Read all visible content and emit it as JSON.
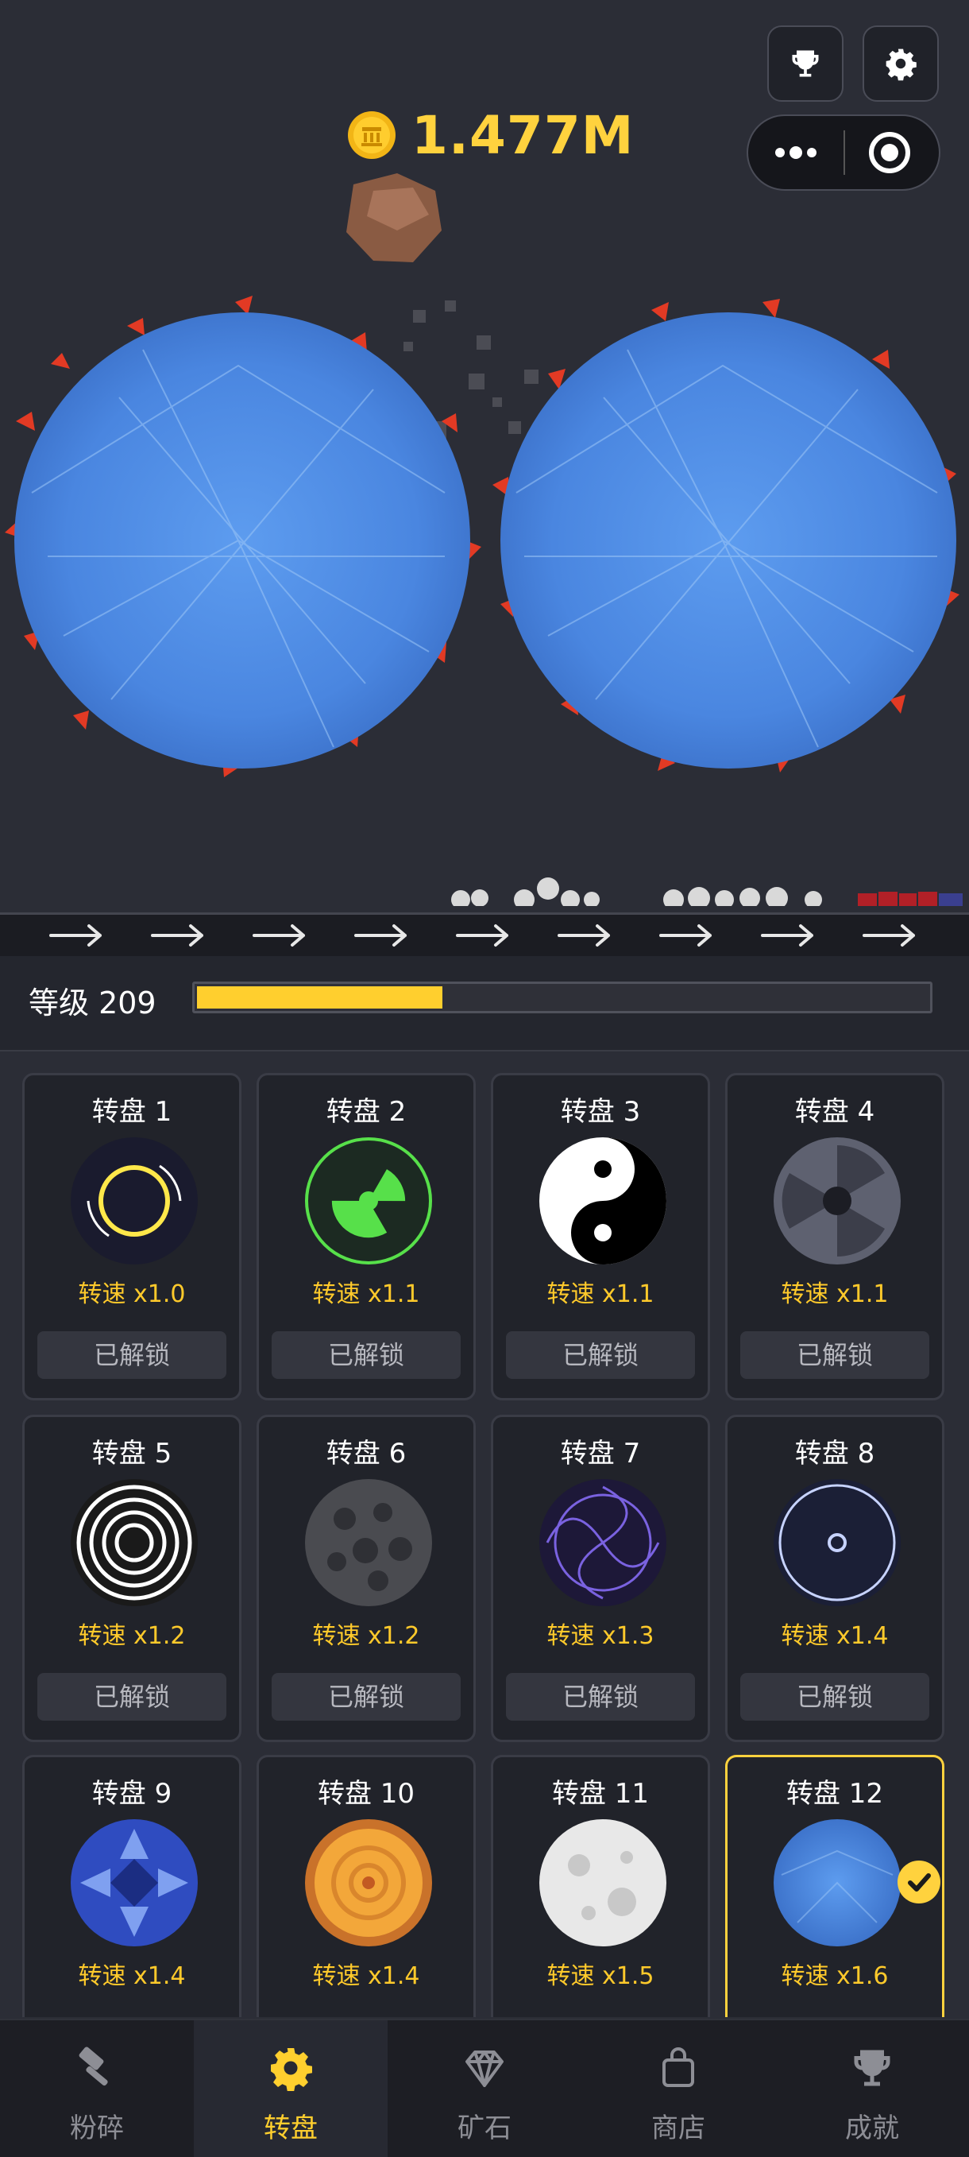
{
  "header": {
    "coin_value": "1.477M",
    "trophy_button": "trophy-icon",
    "settings_button": "gear-icon",
    "menu_dots": "more-dots-icon",
    "close_target": "target-icon"
  },
  "level": {
    "label": "等级 209",
    "progress": 0.34
  },
  "wheels": [
    {
      "title": "转盘 1",
      "speed": "转速 x1.0",
      "status": "已解锁"
    },
    {
      "title": "转盘 2",
      "speed": "转速 x1.1",
      "status": "已解锁"
    },
    {
      "title": "转盘 3",
      "speed": "转速 x1.1",
      "status": "已解锁"
    },
    {
      "title": "转盘 4",
      "speed": "转速 x1.1",
      "status": "已解锁"
    },
    {
      "title": "转盘 5",
      "speed": "转速 x1.2",
      "status": "已解锁"
    },
    {
      "title": "转盘 6",
      "speed": "转速 x1.2",
      "status": "已解锁"
    },
    {
      "title": "转盘 7",
      "speed": "转速 x1.3",
      "status": "已解锁"
    },
    {
      "title": "转盘 8",
      "speed": "转速 x1.4",
      "status": "已解锁"
    },
    {
      "title": "转盘 9",
      "speed": "转速 x1.4"
    },
    {
      "title": "转盘 10",
      "speed": "转速 x1.4"
    },
    {
      "title": "转盘 11",
      "speed": "转速 x1.5"
    },
    {
      "title": "转盘 12",
      "speed": "转速 x1.6",
      "selected": true
    }
  ],
  "tabs": [
    {
      "label": "粉碎",
      "icon": "hammer-icon"
    },
    {
      "label": "转盘",
      "icon": "gear-icon",
      "active": true
    },
    {
      "label": "矿石",
      "icon": "diamond-icon"
    },
    {
      "label": "商店",
      "icon": "shopping-bag-icon"
    },
    {
      "label": "成就",
      "icon": "trophy-icon"
    }
  ],
  "colors": {
    "accent": "#ffd23e",
    "background": "#2b2d36",
    "wheel_blue": "#4a86e0"
  }
}
